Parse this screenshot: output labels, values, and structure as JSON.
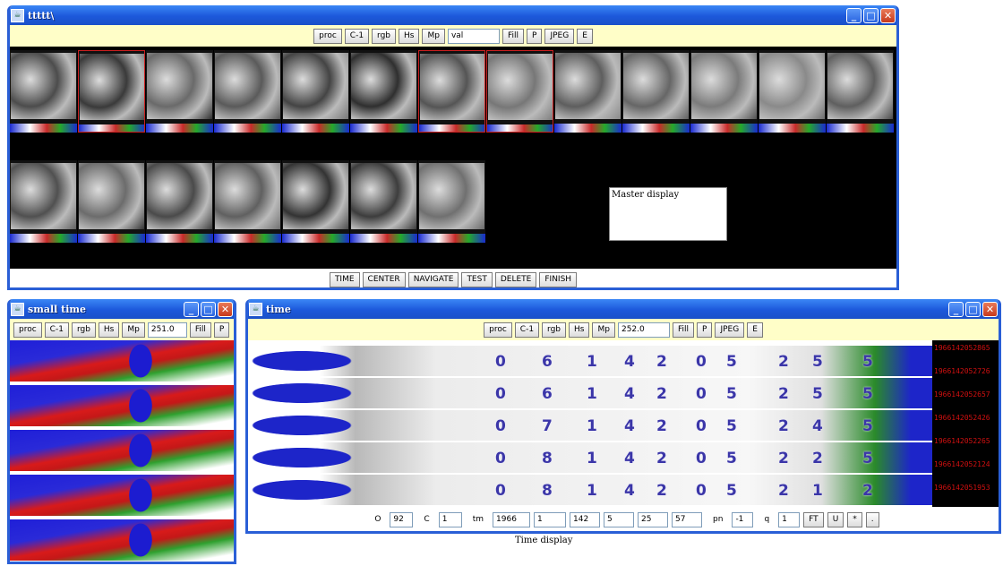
{
  "main_window": {
    "title": "ttttt\\",
    "toolbar": [
      "proc",
      "C-1",
      "rgb",
      "Hs",
      "Mp"
    ],
    "toolbar_field": "val",
    "toolbar_after": [
      "Fill",
      "P",
      "JPEG",
      "E"
    ],
    "master_display_label": "Master display",
    "bottom_buttons": [
      "TIME",
      "CENTER",
      "NAVIGATE",
      "TEST",
      "DELETE",
      "FINISH"
    ]
  },
  "small_window": {
    "title": "small time",
    "toolbar": [
      "proc",
      "C-1",
      "rgb",
      "Hs",
      "Mp"
    ],
    "toolbar_field": "251.0",
    "toolbar_after": [
      "Fill",
      "P"
    ]
  },
  "time_window": {
    "title": "time",
    "toolbar": [
      "proc",
      "C-1",
      "rgb",
      "Hs",
      "Mp"
    ],
    "toolbar_field": "252.0",
    "toolbar_after": [
      "Fill",
      "P",
      "JPEG",
      "E"
    ],
    "timestamps": [
      "1966142052865",
      "1966142052726",
      "1966142052657",
      "1966142052426",
      "1966142052265",
      "1966142052124",
      "1966142051953"
    ],
    "digit_rows": [
      [
        "0",
        "6",
        "1",
        "4",
        "2",
        "0",
        "5",
        "2",
        "5",
        "5"
      ],
      [
        "0",
        "6",
        "1",
        "4",
        "2",
        "0",
        "5",
        "2",
        "5",
        "5"
      ],
      [
        "0",
        "7",
        "1",
        "4",
        "2",
        "0",
        "5",
        "2",
        "4",
        "5"
      ],
      [
        "0",
        "8",
        "1",
        "4",
        "2",
        "0",
        "5",
        "2",
        "2",
        "5"
      ],
      [
        "0",
        "8",
        "1",
        "4",
        "2",
        "0",
        "5",
        "2",
        "1",
        "2"
      ]
    ],
    "fields": [
      {
        "label": "O",
        "value": "92"
      },
      {
        "label": "C",
        "value": "1"
      },
      {
        "label": "tm",
        "value": "1966"
      },
      {
        "label": "",
        "value": "1"
      },
      {
        "label": "",
        "value": "142"
      },
      {
        "label": "",
        "value": "5"
      },
      {
        "label": "",
        "value": "25"
      },
      {
        "label": "",
        "value": "57"
      },
      {
        "label": "pn",
        "value": "-1"
      },
      {
        "label": "q",
        "value": "1"
      }
    ],
    "field_buttons": [
      "FT",
      "U",
      "*",
      "."
    ]
  },
  "time_display_label": "Time display",
  "colors": {
    "titlebar": "#1c58db",
    "toolbar_bg": "#fffec8",
    "timestamp": "#d01010",
    "digit": "#3b36a8"
  }
}
